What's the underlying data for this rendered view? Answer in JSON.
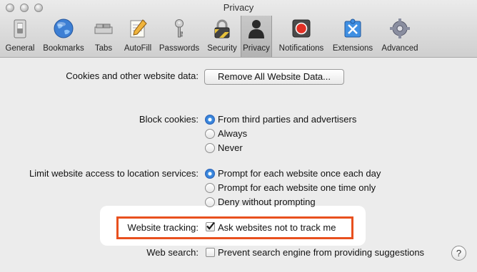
{
  "window": {
    "title": "Privacy"
  },
  "toolbar": {
    "items": [
      {
        "label": "General",
        "icon": "general-switch-icon"
      },
      {
        "label": "Bookmarks",
        "icon": "globe-icon"
      },
      {
        "label": "Tabs",
        "icon": "tabs-icon"
      },
      {
        "label": "AutoFill",
        "icon": "autofill-pencil-icon"
      },
      {
        "label": "Passwords",
        "icon": "key-icon"
      },
      {
        "label": "Security",
        "icon": "lock-icon"
      },
      {
        "label": "Privacy",
        "icon": "person-silhouette-icon",
        "selected": true
      },
      {
        "label": "Notifications",
        "icon": "notifications-red-dot-icon"
      },
      {
        "label": "Extensions",
        "icon": "puzzle-icon"
      },
      {
        "label": "Advanced",
        "icon": "gear-icon"
      }
    ]
  },
  "cookies": {
    "label": "Cookies and other website data:",
    "remove_button": "Remove All Website Data..."
  },
  "block_cookies": {
    "label": "Block cookies:",
    "options": [
      "From third parties and advertisers",
      "Always",
      "Never"
    ],
    "selected": 0
  },
  "location": {
    "label": "Limit website access to location services:",
    "options": [
      "Prompt for each website once each day",
      "Prompt for each website one time only",
      "Deny without prompting"
    ],
    "selected": 0
  },
  "tracking": {
    "label": "Website tracking:",
    "checkbox_label": "Ask websites not to track me",
    "checked": true
  },
  "web_search": {
    "label": "Web search:",
    "checkbox_label": "Prevent search engine from providing suggestions",
    "checked": false
  },
  "help_button": "?",
  "colors": {
    "highlight": "#e8501e",
    "radio_accent": "#2f6fcf"
  }
}
